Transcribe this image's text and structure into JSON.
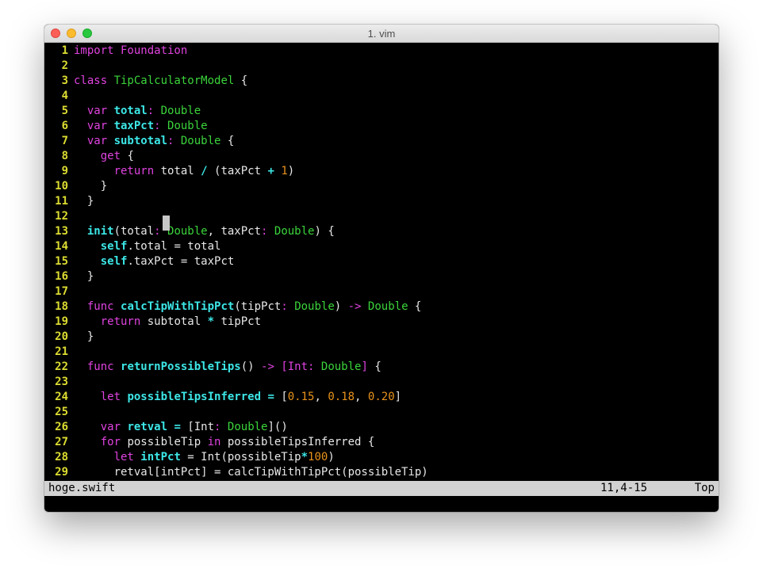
{
  "window": {
    "title": "1. vim"
  },
  "editor": {
    "lines": [
      {
        "n": "1",
        "tokens": [
          [
            "kw",
            "import Foundation"
          ]
        ]
      },
      {
        "n": "2",
        "tokens": []
      },
      {
        "n": "3",
        "tokens": [
          [
            "kw",
            "class "
          ],
          [
            "ty",
            "TipCalculatorModel"
          ],
          [
            "pl",
            " {"
          ]
        ]
      },
      {
        "n": "4",
        "tokens": []
      },
      {
        "n": "5",
        "tokens": [
          [
            "pl",
            "  "
          ],
          [
            "kw",
            "var "
          ],
          [
            "id",
            "total"
          ],
          [
            "kw",
            ": "
          ],
          [
            "ty",
            "Double"
          ]
        ]
      },
      {
        "n": "6",
        "tokens": [
          [
            "pl",
            "  "
          ],
          [
            "kw",
            "var "
          ],
          [
            "id",
            "taxPct"
          ],
          [
            "kw",
            ": "
          ],
          [
            "ty",
            "Double"
          ]
        ]
      },
      {
        "n": "7",
        "tokens": [
          [
            "pl",
            "  "
          ],
          [
            "kw",
            "var "
          ],
          [
            "id",
            "subtotal"
          ],
          [
            "kw",
            ": "
          ],
          [
            "ty",
            "Double"
          ],
          [
            "pl",
            " {"
          ]
        ]
      },
      {
        "n": "8",
        "tokens": [
          [
            "pl",
            "    "
          ],
          [
            "kw",
            "get"
          ],
          [
            "pl",
            " {"
          ]
        ]
      },
      {
        "n": "9",
        "tokens": [
          [
            "pl",
            "      "
          ],
          [
            "kw",
            "return"
          ],
          [
            "pl",
            " total "
          ],
          [
            "id",
            "/"
          ],
          [
            "pl",
            " (taxPct "
          ],
          [
            "id",
            "+"
          ],
          [
            "pl",
            " "
          ],
          [
            "nm",
            "1"
          ],
          [
            "pl",
            ")"
          ]
        ]
      },
      {
        "n": "10",
        "tokens": [
          [
            "pl",
            "    }"
          ]
        ]
      },
      {
        "n": "11",
        "tokens": [
          [
            "pl",
            "  }"
          ]
        ]
      },
      {
        "n": "12",
        "tokens": []
      },
      {
        "n": "13",
        "tokens": [
          [
            "pl",
            "  "
          ],
          [
            "id",
            "init"
          ],
          [
            "pl",
            "(total"
          ],
          [
            "kw",
            ": "
          ],
          [
            "ty",
            "Double"
          ],
          [
            "pl",
            ", taxPct"
          ],
          [
            "kw",
            ": "
          ],
          [
            "ty",
            "Double"
          ],
          [
            "pl",
            ") {"
          ]
        ]
      },
      {
        "n": "14",
        "tokens": [
          [
            "pl",
            "    "
          ],
          [
            "id",
            "self"
          ],
          [
            "pl",
            ".total = total"
          ]
        ]
      },
      {
        "n": "15",
        "tokens": [
          [
            "pl",
            "    "
          ],
          [
            "id",
            "self"
          ],
          [
            "pl",
            ".taxPct = taxPct"
          ]
        ]
      },
      {
        "n": "16",
        "tokens": [
          [
            "pl",
            "  }"
          ]
        ]
      },
      {
        "n": "17",
        "tokens": []
      },
      {
        "n": "18",
        "tokens": [
          [
            "pl",
            "  "
          ],
          [
            "kw",
            "func "
          ],
          [
            "id",
            "calcTipWithTipPct"
          ],
          [
            "pl",
            "(tipPct"
          ],
          [
            "kw",
            ": "
          ],
          [
            "ty",
            "Double"
          ],
          [
            "pl",
            ") "
          ],
          [
            "kw",
            "-> "
          ],
          [
            "ty",
            "Double"
          ],
          [
            "pl",
            " {"
          ]
        ]
      },
      {
        "n": "19",
        "tokens": [
          [
            "pl",
            "    "
          ],
          [
            "kw",
            "return"
          ],
          [
            "pl",
            " subtotal "
          ],
          [
            "id",
            "*"
          ],
          [
            "pl",
            " tipPct"
          ]
        ]
      },
      {
        "n": "20",
        "tokens": [
          [
            "pl",
            "  }"
          ]
        ]
      },
      {
        "n": "21",
        "tokens": []
      },
      {
        "n": "22",
        "tokens": [
          [
            "pl",
            "  "
          ],
          [
            "kw",
            "func "
          ],
          [
            "id",
            "returnPossibleTips"
          ],
          [
            "pl",
            "() "
          ],
          [
            "kw",
            "-> [Int: "
          ],
          [
            "ty",
            "Double"
          ],
          [
            "kw",
            "]"
          ],
          [
            "pl",
            " {"
          ]
        ]
      },
      {
        "n": "23",
        "tokens": []
      },
      {
        "n": "24",
        "tokens": [
          [
            "pl",
            "    "
          ],
          [
            "kw",
            "let "
          ],
          [
            "id",
            "possibleTipsInferred"
          ],
          [
            "pl",
            " "
          ],
          [
            "id",
            "="
          ],
          [
            "pl",
            " ["
          ],
          [
            "nm",
            "0.15"
          ],
          [
            "pl",
            ", "
          ],
          [
            "nm",
            "0.18"
          ],
          [
            "pl",
            ", "
          ],
          [
            "nm",
            "0.20"
          ],
          [
            "pl",
            "]"
          ]
        ]
      },
      {
        "n": "25",
        "tokens": []
      },
      {
        "n": "26",
        "tokens": [
          [
            "pl",
            "    "
          ],
          [
            "kw",
            "var "
          ],
          [
            "id",
            "retval"
          ],
          [
            "pl",
            " "
          ],
          [
            "id",
            "="
          ],
          [
            "pl",
            " [Int"
          ],
          [
            "kw",
            ": "
          ],
          [
            "ty",
            "Double"
          ],
          [
            "pl",
            "]()"
          ]
        ]
      },
      {
        "n": "27",
        "tokens": [
          [
            "pl",
            "    "
          ],
          [
            "kw",
            "for"
          ],
          [
            "pl",
            " possibleTip "
          ],
          [
            "kw",
            "in"
          ],
          [
            "pl",
            " possibleTipsInferred {"
          ]
        ]
      },
      {
        "n": "28",
        "tokens": [
          [
            "pl",
            "      "
          ],
          [
            "kw",
            "let "
          ],
          [
            "id",
            "intPct"
          ],
          [
            "pl",
            " = Int(possibleTip"
          ],
          [
            "id",
            "*"
          ],
          [
            "nm",
            "100"
          ],
          [
            "pl",
            ")"
          ]
        ]
      },
      {
        "n": "29",
        "tokens": [
          [
            "pl",
            "      retval[intPct] = calcTipWithTipPct(possibleTip)"
          ]
        ]
      }
    ]
  },
  "statusbar": {
    "filename": "hoge.swift",
    "position": "11,4-15",
    "scroll": "Top"
  }
}
